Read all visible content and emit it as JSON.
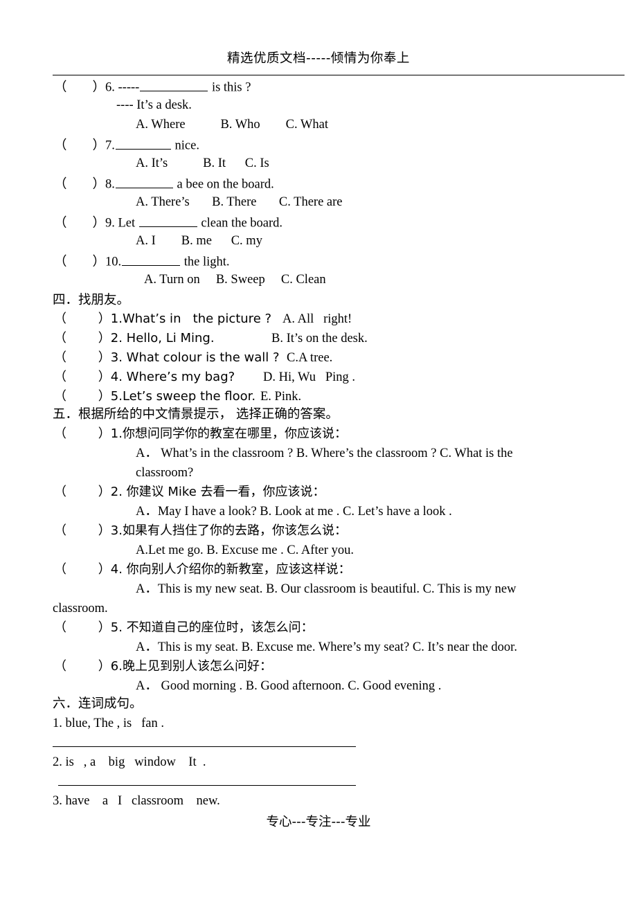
{
  "document": {
    "header": "精选优质文档-----倾情为你奉上",
    "footer": "专心---专注---专业"
  },
  "section_three_tail": {
    "q6": {
      "marker": "（        ）6. -----",
      "tail": " is this ?",
      "answer_line": "---- It’s a desk.",
      "options": "A. Where           B. Who        C. What"
    },
    "q7": {
      "marker": "（        ）7.",
      "tail": " nice.",
      "options": "A. It’s           B. It      C. Is"
    },
    "q8": {
      "marker": "（        ）8.",
      "tail": " a bee on the board.",
      "options": "A. There’s       B. There       C. There are"
    },
    "q9": {
      "marker": "（        ）9. Let ",
      "tail": " clean the board.",
      "options": "A. I        B. me      C. my"
    },
    "q10": {
      "marker": "（        ）10.",
      "tail": " the light.",
      "options": "A. Turn on     B. Sweep     C. Clean"
    }
  },
  "section_four": {
    "title": "四．找朋友。",
    "items": [
      {
        "marker": "（        ）1.What’s in   the picture ?",
        "match": "A. All   right!"
      },
      {
        "marker": "（        ）2. Hello, Li Ming.",
        "match": "B. It’s on the desk."
      },
      {
        "marker": "（        ）3. What colour is the wall ?",
        "match": "C.A tree."
      },
      {
        "marker": "（        ）4. Where’s my bag?",
        "match": "D. Hi, Wu   Ping ."
      },
      {
        "marker": "（        ）5.Let’s sweep the floor.",
        "match": "E. Pink."
      }
    ]
  },
  "section_five": {
    "title": "五．根据所给的中文情景提示， 选择正确的答案。",
    "items": [
      {
        "marker": "（        ）1.你想问同学你的教室在哪里，你应该说：",
        "options_line1": "A．   What’s  in  the  classroom  ?    B. Where’s  the  classroom  ?    C.  What  is  the",
        "options_line2": "classroom?"
      },
      {
        "marker": "（        ）2. 你建议 Mike 去看一看，你应该说：",
        "options_line1": "A．May I have a look?     B. Look at me .    C. Let’s have a look ."
      },
      {
        "marker": "（        ）3.如果有人挡住了你的去路，你该怎么说：",
        "options_line1": "A.Let me go.     B. Excuse   me .     C. After you."
      },
      {
        "marker": "（        ）4. 你向别人介绍你的新教室，应该这样说：",
        "options_line1": "A．This  is  my  new  seat.      B. Our  classroom  is  beautiful.     C.  This  is  my  new",
        "options_line2": "classroom."
      },
      {
        "marker": "（        ）5. 不知道自己的座位时，该怎么问：",
        "options_line1": "A．This is my seat.     B. Excuse me. Where’s my   seat?    C. It’s near the door."
      },
      {
        "marker": "（        ）6.晚上见到别人该怎么问好：",
        "options_line1": "A．      Good morning .   B. Good afternoon.    C. Good evening ."
      }
    ]
  },
  "section_six": {
    "title": "六．连词成句。",
    "items": [
      {
        "prompt": "1. blue, The , is   fan ."
      },
      {
        "prompt": "2. is   , a    big   window    It  ."
      },
      {
        "prompt": "3. have    a   I   classroom    new."
      }
    ]
  }
}
